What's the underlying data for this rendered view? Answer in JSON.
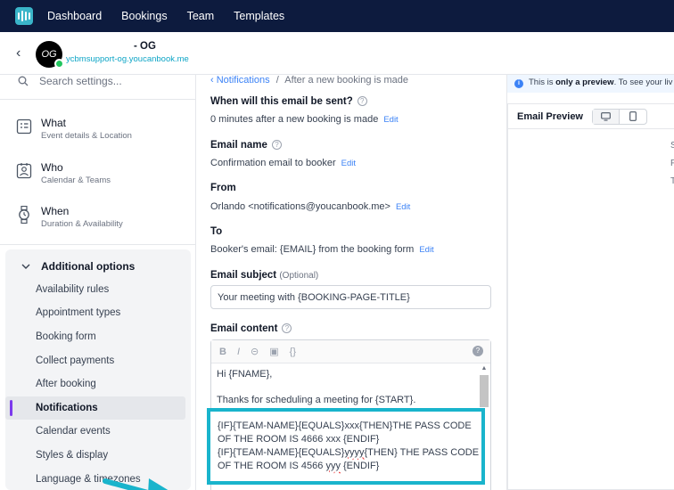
{
  "topnav": {
    "items": [
      "Dashboard",
      "Bookings",
      "Team",
      "Templates"
    ]
  },
  "header": {
    "avatar_text": "OG",
    "page_name": "- OG",
    "page_url": "ycbmsupport-og.youcanbook.me"
  },
  "sidebar": {
    "search_placeholder": "Search settings...",
    "sections": [
      {
        "title": "What",
        "subtitle": "Event details & Location",
        "icon": "list-card-icon"
      },
      {
        "title": "Who",
        "subtitle": "Calendar & Teams",
        "icon": "contact-card-icon"
      },
      {
        "title": "When",
        "subtitle": "Duration & Availability",
        "icon": "watch-icon"
      }
    ],
    "additional_title": "Additional options",
    "additional_items": [
      "Availability rules",
      "Appointment types",
      "Booking form",
      "Collect payments",
      "After booking",
      "Notifications",
      "Calendar events",
      "Styles & display",
      "Language & timezones"
    ],
    "active_item": "Notifications"
  },
  "content": {
    "breadcrumb_link": "Notifications",
    "breadcrumb_sep": "/",
    "breadcrumb_current": "After a new booking is made",
    "when_label": "When will this email be sent?",
    "when_value": "0 minutes after a new booking is made",
    "email_name_label": "Email name",
    "email_name_value": "Confirmation email to booker",
    "from_label": "From",
    "from_value": "Orlando <notifications@youcanbook.me>",
    "to_label": "To",
    "to_value": "Booker's email: {EMAIL} from the booking form",
    "edit_label": "Edit",
    "subject_label": "Email subject",
    "subject_optional": "(Optional)",
    "subject_value": "Your meeting with {BOOKING-PAGE-TITLE}",
    "content_label": "Email content",
    "toolbar": {
      "bold": "B",
      "italic": "I",
      "link": "⊝",
      "image": "▣",
      "code": "{}",
      "help": "?"
    },
    "editor_lines": [
      "Hi {FNAME},",
      "Thanks for scheduling a meeting for {START}."
    ],
    "highlight_lines": [
      "{IF}{TEAM-NAME}{EQUALS}xxx{THEN}THE PASS CODE",
      "OF THE ROOM IS 4666 xxx {ENDIF}",
      "{IF}{TEAM-NAME}{EQUALS}yyyy{THEN} THE PASS CODE",
      "OF THE ROOM IS 4566 yyy {ENDIF}"
    ]
  },
  "preview": {
    "info_prefix": "This is",
    "info_bold": "only a preview",
    "info_suffix": ". To see your liv",
    "title": "Email Preview",
    "cut_letters": [
      "S",
      "F",
      "T"
    ]
  },
  "colors": {
    "nav_bg": "#0d1b3e",
    "accent": "#19b4cc",
    "link": "#3b82f6",
    "active_bar": "#7c3aed"
  }
}
